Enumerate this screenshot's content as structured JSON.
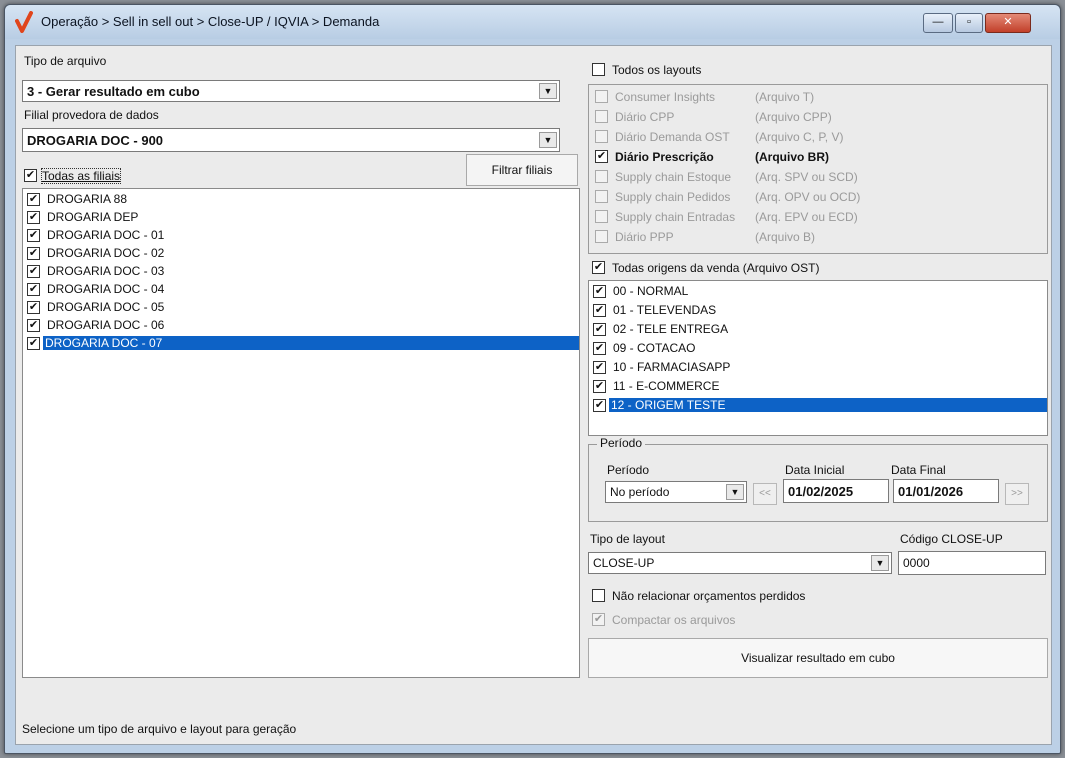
{
  "window": {
    "title": "Operação > Sell in sell out > Close-UP / IQVIA > Demanda",
    "min_label": "—",
    "max_label": "▫",
    "close_label": "✕"
  },
  "left": {
    "tipo_arquivo_label": "Tipo de arquivo",
    "tipo_arquivo_value": "3 - Gerar resultado em cubo",
    "filial_label": "Filial provedora de dados",
    "filial_value": "DROGARIA DOC - 900",
    "todas_filiais_label": "Todas as filiais",
    "filtrar_button": "Filtrar filiais",
    "filiais": [
      "DROGARIA 88",
      "DROGARIA DEP",
      "DROGARIA DOC - 01",
      "DROGARIA DOC - 02",
      "DROGARIA DOC - 03",
      "DROGARIA DOC - 04",
      "DROGARIA DOC - 05",
      "DROGARIA DOC - 06",
      "DROGARIA DOC - 07"
    ]
  },
  "right": {
    "todos_layouts_label": "Todos os layouts",
    "layouts": [
      {
        "name": "Consumer Insights",
        "file": "(Arquivo T)"
      },
      {
        "name": "Diário CPP",
        "file": "(Arquivo CPP)"
      },
      {
        "name": "Diário Demanda OST",
        "file": "(Arquivo C, P, V)"
      },
      {
        "name": "Diário Prescrição",
        "file": "(Arquivo BR)"
      },
      {
        "name": "Supply chain Estoque",
        "file": "(Arq. SPV ou SCD)"
      },
      {
        "name": "Supply chain Pedidos",
        "file": "(Arq. OPV ou OCD)"
      },
      {
        "name": "Supply chain Entradas",
        "file": "(Arq. EPV ou ECD)"
      },
      {
        "name": "Diário PPP",
        "file": "(Arquivo B)"
      }
    ],
    "todas_origens_label": "Todas origens da venda (Arquivo OST)",
    "origens": [
      "00 - NORMAL",
      "01 - TELEVENDAS",
      "02 - TELE ENTREGA",
      "09 - COTACAO",
      "10 - FARMACIASAPP",
      "11 - E-COMMERCE",
      "12 - ORIGEM TESTE"
    ],
    "periodo_group": "Período",
    "periodo_label": "Período",
    "periodo_value": "No período",
    "data_inicial_label": "Data Inicial",
    "data_inicial_value": "01/02/2025",
    "data_final_label": "Data Final",
    "data_final_value": "01/01/2026",
    "prev_label": "<<",
    "next_label": ">>",
    "tipo_layout_label": "Tipo de layout",
    "tipo_layout_value": "CLOSE-UP",
    "codigo_label": "Código CLOSE-UP",
    "codigo_value": "0000",
    "nao_relacionar_label": "Não relacionar orçamentos perdidos",
    "compactar_label": "Compactar os arquivos",
    "visualizar_button": "Visualizar resultado em cubo"
  },
  "status": {
    "text": "Selecione um tipo de arquivo e layout para geração"
  }
}
